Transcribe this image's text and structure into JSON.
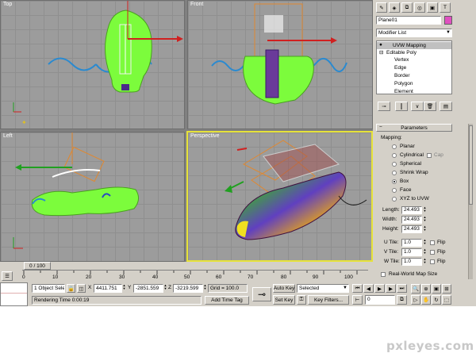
{
  "viewports": {
    "top": {
      "label": "Top"
    },
    "front": {
      "label": "Front"
    },
    "left": {
      "label": "Left"
    },
    "perspective": {
      "label": "Perspective"
    }
  },
  "command_panel": {
    "object_name": "Plane01",
    "modifier_list": "Modifier List",
    "stack": {
      "uvw_mapping": "UVW Mapping",
      "editable_poly": "Editable Poly",
      "sub": [
        "Vertex",
        "Edge",
        "Border",
        "Polygon",
        "Element"
      ]
    },
    "rollout_title": "Parameters",
    "mapping_label": "Mapping:",
    "mapping_options": [
      "Planar",
      "Cylindrical",
      "Spherical",
      "Shrink Wrap",
      "Box",
      "Face",
      "XYZ to UVW"
    ],
    "selected_mapping": "Box",
    "cap_label": "Cap",
    "length_label": "Length:",
    "length_value": "24.493",
    "width_label": "Width:",
    "width_value": "24.493",
    "height_label": "Height:",
    "height_value": "24.493",
    "utile_label": "U Tile:",
    "utile_value": "1.0",
    "vtile_label": "V Tile:",
    "vtile_value": "1.0",
    "wtile_label": "W Tile:",
    "wtile_value": "1.0",
    "flip_label": "Flip",
    "real_world_label": "Real-World Map Size"
  },
  "timeline": {
    "slider": "0 / 100",
    "ticks": [
      "0",
      "10",
      "20",
      "30",
      "40",
      "50",
      "60",
      "70",
      "80",
      "90",
      "100"
    ]
  },
  "status": {
    "selection": "1 Object Sele",
    "rendering_time": "Rendering Time  0:00:19",
    "x_label": "X",
    "x_value": "4411.751",
    "y_label": "Y",
    "y_value": "-2851.559",
    "z_label": "Z",
    "z_value": "-3219.599",
    "grid": "Grid = 100.0",
    "add_time_tag": "Add Time Tag",
    "auto_key": "Auto Key",
    "set_key": "Set Key",
    "selected_dropdown": "Selected",
    "key_filters": "Key Filters...",
    "frame": "0"
  },
  "watermark": "pxleyes.com",
  "colors": {
    "selection_green": "#7cfc3c",
    "viewport_bg": "#9c9c9c",
    "active_border": "#e6e23a",
    "ui_gray": "#d4d0c8",
    "stack_highlight": "#c0c0c0"
  }
}
